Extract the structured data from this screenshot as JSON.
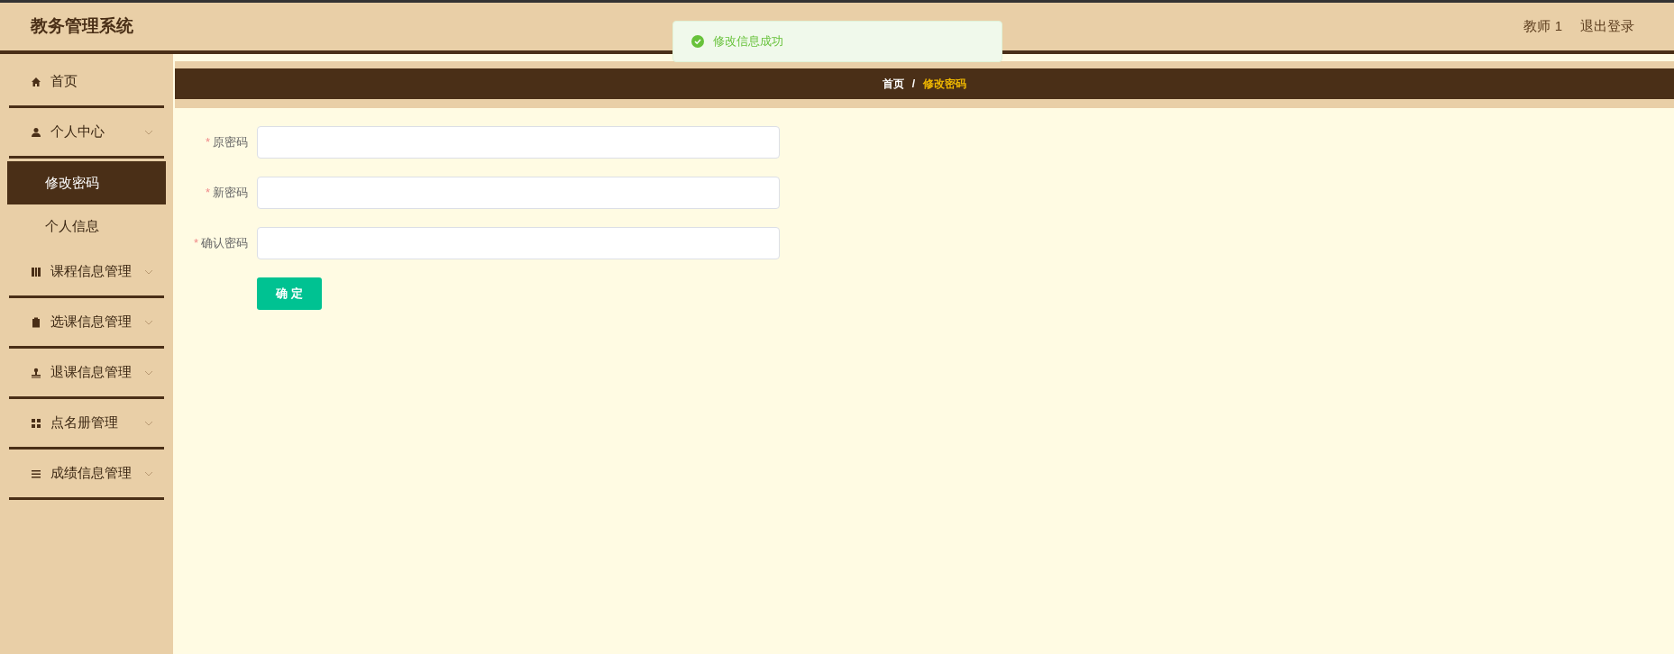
{
  "header": {
    "title": "教务管理系统",
    "user": "教师 1",
    "logout": "退出登录"
  },
  "toast": {
    "message": "修改信息成功"
  },
  "sidebar": {
    "items": [
      {
        "label": "首页",
        "kind": "link",
        "selected": false
      },
      {
        "label": "个人中心",
        "kind": "group",
        "selected": false,
        "children": [
          {
            "label": "修改密码",
            "selected": true
          },
          {
            "label": "个人信息",
            "selected": false
          }
        ]
      },
      {
        "label": "课程信息管理",
        "kind": "group",
        "selected": false
      },
      {
        "label": "选课信息管理",
        "kind": "group",
        "selected": false
      },
      {
        "label": "退课信息管理",
        "kind": "group",
        "selected": false
      },
      {
        "label": "点名册管理",
        "kind": "group",
        "selected": false
      },
      {
        "label": "成绩信息管理",
        "kind": "group",
        "selected": false
      }
    ]
  },
  "breadcrumb": {
    "separator": "/",
    "items": [
      {
        "label": "首页"
      },
      {
        "label": "修改密码"
      }
    ]
  },
  "form": {
    "fields": [
      {
        "mark": "*",
        "label": "原密码"
      },
      {
        "mark": "*",
        "label": "新密码"
      },
      {
        "mark": "*",
        "label": "确认密码"
      }
    ],
    "submit": "确 定"
  }
}
